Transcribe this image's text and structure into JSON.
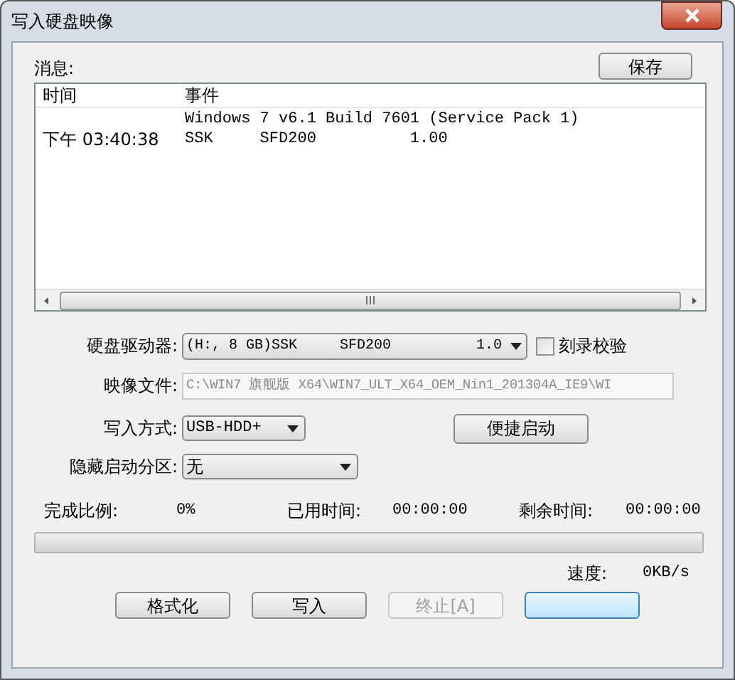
{
  "window": {
    "title": "写入硬盘映像"
  },
  "messages": {
    "label": "消息:",
    "save_button": "保存",
    "columns": [
      "时间",
      "事件"
    ],
    "rows": [
      {
        "event": "Windows 7 v6.1 Build 7601 (Service Pack 1)"
      },
      {
        "time": "下午 03:40:38",
        "event": "SSK     SFD200          1.00"
      }
    ]
  },
  "drive": {
    "label": "硬盘驱动器:",
    "value": "(H:, 8 GB)SSK     SFD200          1.0"
  },
  "verify": {
    "label": "刻录校验",
    "checked": false
  },
  "image_file": {
    "label": "映像文件:",
    "value": "C:\\WIN7 旗舰版 X64\\WIN7_ULT_X64_OEM_Nin1_201304A_IE9\\WI",
    "disabled": true
  },
  "write_mode": {
    "label": "写入方式:",
    "value": "USB-HDD+"
  },
  "quick_boot_button": "便捷启动",
  "hidden_partition": {
    "label": "隐藏启动分区:",
    "value": "无"
  },
  "stats": [
    {
      "label": "完成比例:",
      "value": "0%"
    },
    {
      "label": "已用时间:",
      "value": "00:00:00"
    },
    {
      "label": "剩余时间:",
      "value": "00:00:00"
    }
  ],
  "progress": {
    "level": 0
  },
  "speed": {
    "label": "速度:",
    "value": "0KB/s"
  },
  "buttons": [
    {
      "label": "格式化",
      "disabled": false
    },
    {
      "label": "写入",
      "disabled": false
    },
    {
      "label": "终止[A]",
      "disabled": true
    }
  ]
}
